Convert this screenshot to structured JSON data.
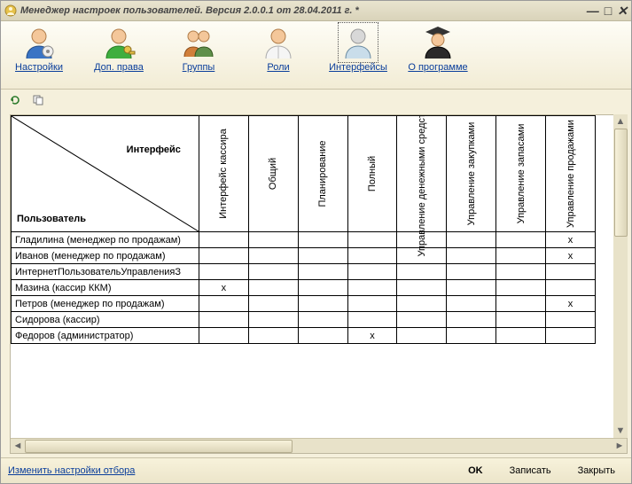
{
  "window": {
    "title": "Менеджер настроек пользователей. Версия 2.0.0.1 от 28.04.2011 г. *"
  },
  "toolbar": [
    {
      "key": "settings",
      "label": "Настройки"
    },
    {
      "key": "extra",
      "label": "Доп. права"
    },
    {
      "key": "groups",
      "label": "Группы"
    },
    {
      "key": "roles",
      "label": "Роли"
    },
    {
      "key": "interfaces",
      "label": "Интерфейсы",
      "active": true
    },
    {
      "key": "about",
      "label": "О программе"
    }
  ],
  "grid": {
    "corner_top": "Интерфейс",
    "corner_bottom": "Пользователь",
    "columns": [
      "Интерфейс кассира",
      "Общий",
      "Планирование",
      "Полный",
      "Управление денежными средствами",
      "Управление закупками",
      "Управление запасами",
      "Управление продажами"
    ],
    "rows": [
      {
        "label": "Гладилина  (менеджер по продажам)",
        "marks": [
          "",
          "",
          "",
          "",
          "",
          "",
          "",
          "x"
        ]
      },
      {
        "label": "Иванов (менеджер по продажам)",
        "marks": [
          "",
          "",
          "",
          "",
          "",
          "",
          "",
          "x"
        ]
      },
      {
        "label": "ИнтернетПользовательУправленияЗ",
        "marks": [
          "",
          "",
          "",
          "",
          "",
          "",
          "",
          ""
        ]
      },
      {
        "label": "Мазина (кассир ККМ)",
        "marks": [
          "x",
          "",
          "",
          "",
          "",
          "",
          "",
          ""
        ]
      },
      {
        "label": "Петров (менеджер по продажам)",
        "marks": [
          "",
          "",
          "",
          "",
          "",
          "",
          "",
          "x"
        ]
      },
      {
        "label": "Сидорова (кассир)",
        "marks": [
          "",
          "",
          "",
          "",
          "",
          "",
          "",
          ""
        ]
      },
      {
        "label": "Федоров (администратор)",
        "marks": [
          "",
          "",
          "",
          "x",
          "",
          "",
          "",
          ""
        ]
      }
    ]
  },
  "footer": {
    "filter_link": "Изменить настройки отбора",
    "ok": "OK",
    "save": "Записать",
    "close": "Закрыть"
  }
}
